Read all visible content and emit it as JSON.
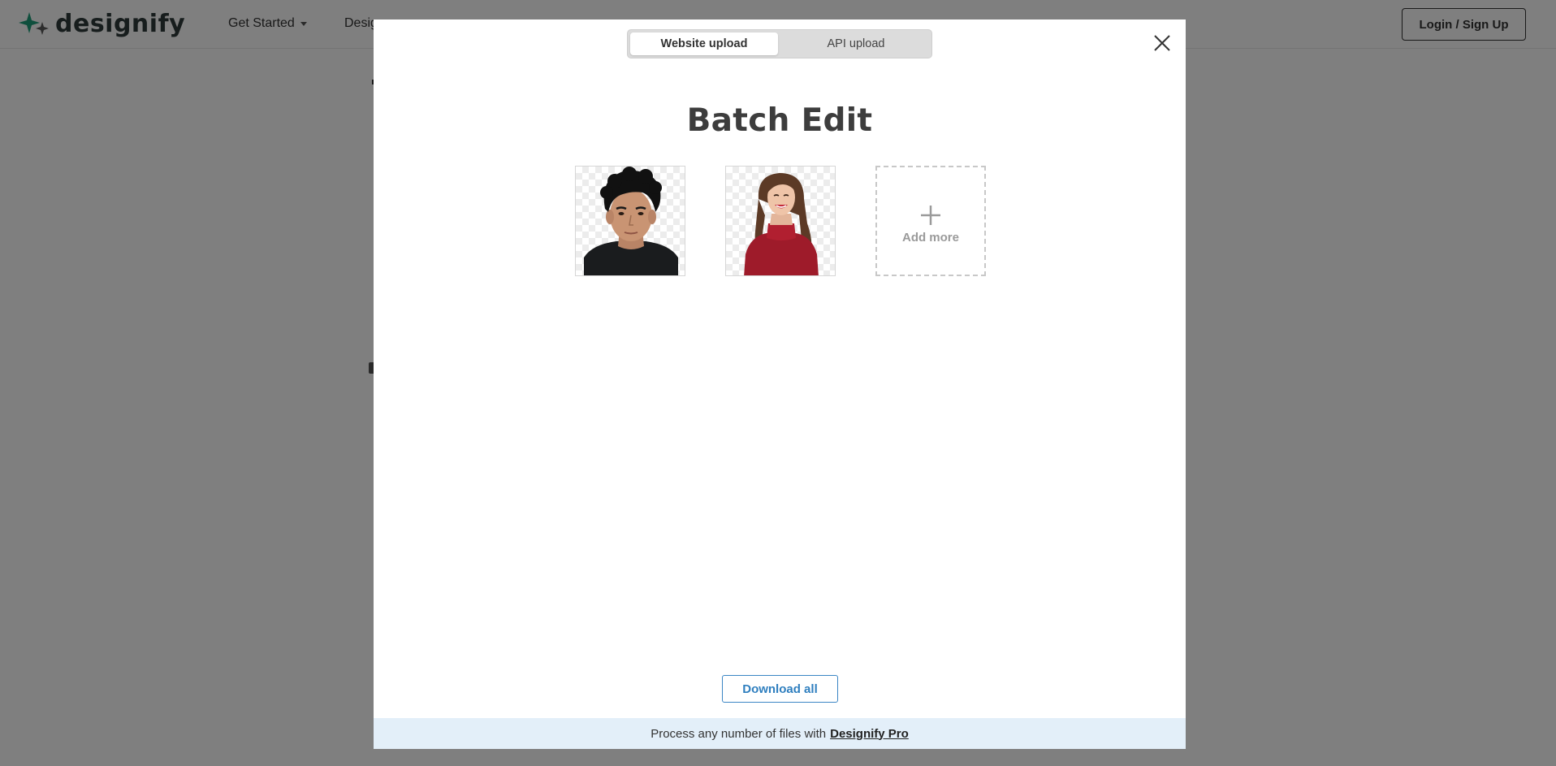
{
  "site": {
    "logo_text": "designify",
    "nav": [
      {
        "label": "Get Started",
        "has_dropdown": true
      },
      {
        "label": "Desig",
        "has_dropdown": false
      }
    ],
    "login_label": "Login / Sign Up",
    "brand_colors": {
      "primary": "#1f9e7a",
      "accent": "#3b86c4",
      "dark": "#2f3b3a"
    }
  },
  "modal": {
    "tabs": [
      {
        "label": "Website upload",
        "active": true
      },
      {
        "label": "API upload",
        "active": false
      }
    ],
    "close_icon": "close-icon",
    "title": "Batch Edit",
    "images": [
      {
        "name": "image-thumbnail-man"
      },
      {
        "name": "image-thumbnail-woman"
      }
    ],
    "add_more_label": "Add more",
    "download_label": "Download all",
    "promo": {
      "text": "Process any number of files with",
      "link": "Designify Pro"
    }
  }
}
